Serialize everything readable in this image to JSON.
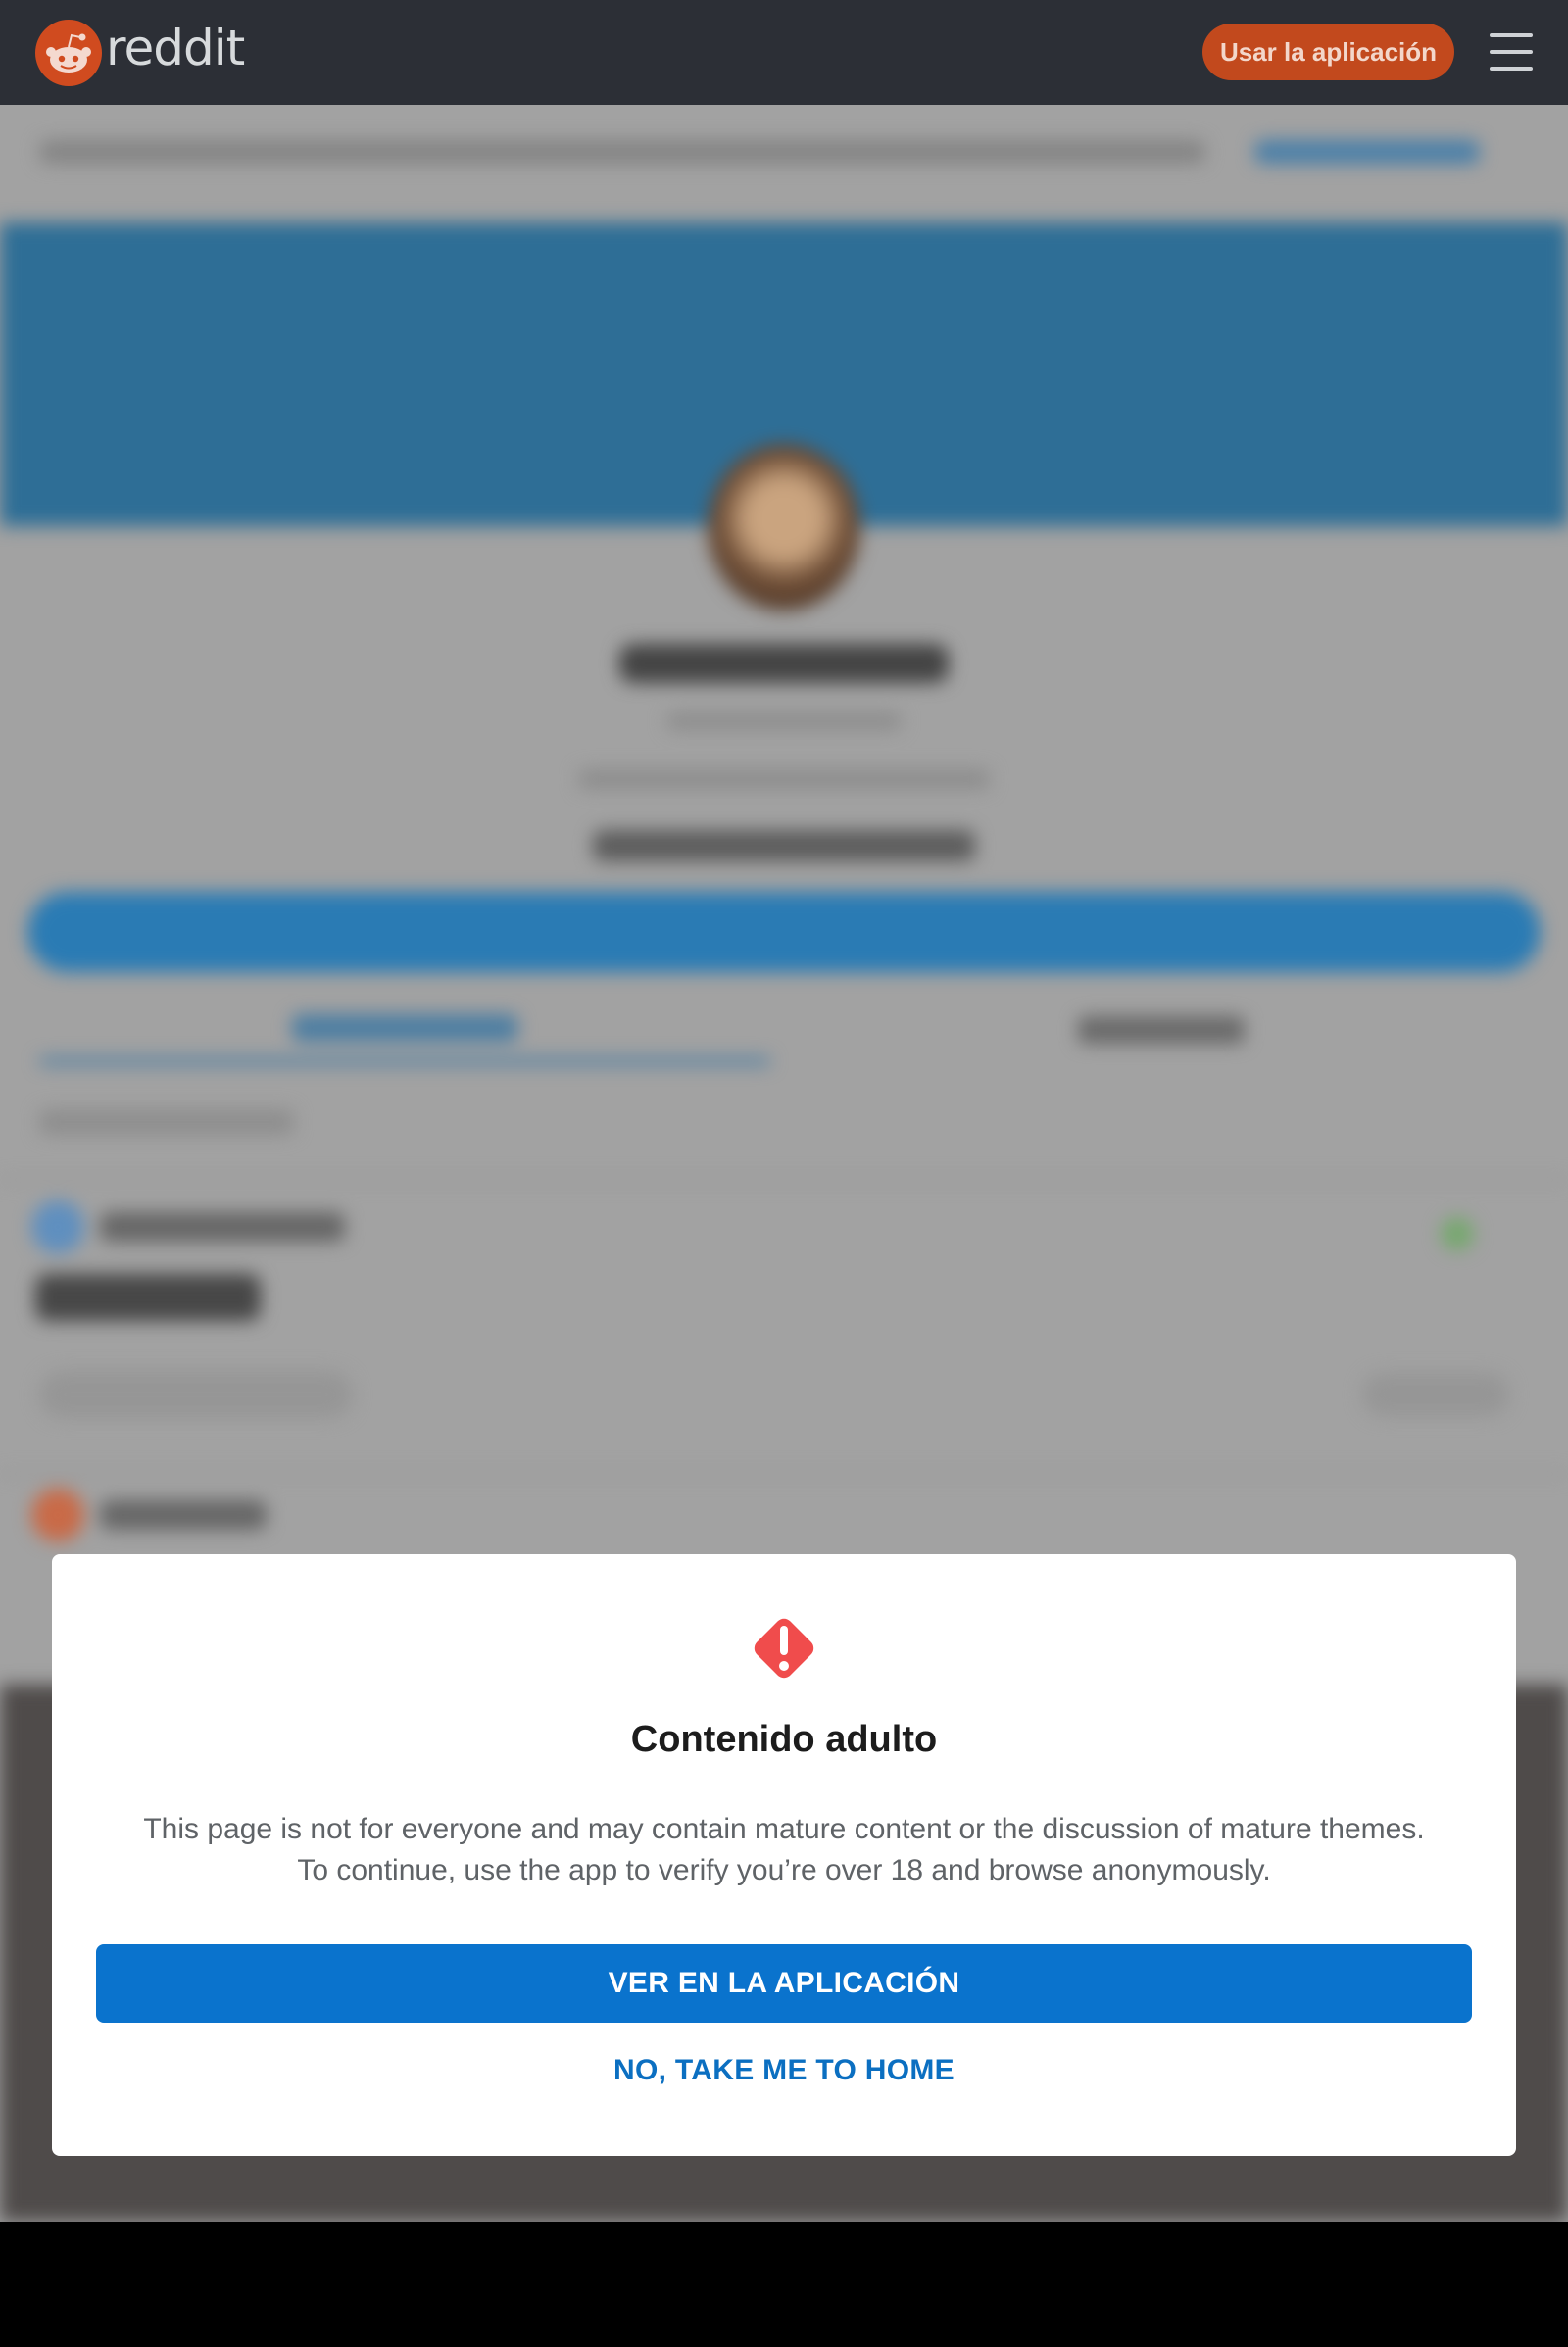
{
  "header": {
    "wordmark": "reddit",
    "use_app_label": "Usar la aplicación"
  },
  "modal": {
    "title": "Contenido adulto",
    "body_line1": "This page is not for everyone and may contain mature content or the discussion of mature themes.",
    "body_line2": "To continue, use the app to verify you’re over 18 and browse anonymously.",
    "primary_button": "VER EN LA APLICACIÓN",
    "secondary_button": "NO, TAKE ME TO HOME"
  },
  "colors": {
    "header_bg": "#2c2f36",
    "brand_orange": "#c2491d",
    "primary_blue": "#0a73cd",
    "warning_red": "#f04c4c"
  },
  "icons": {
    "logo": "reddit-snoo-icon",
    "menu": "hamburger-menu-icon",
    "warning": "warning-exclamation-icon"
  }
}
